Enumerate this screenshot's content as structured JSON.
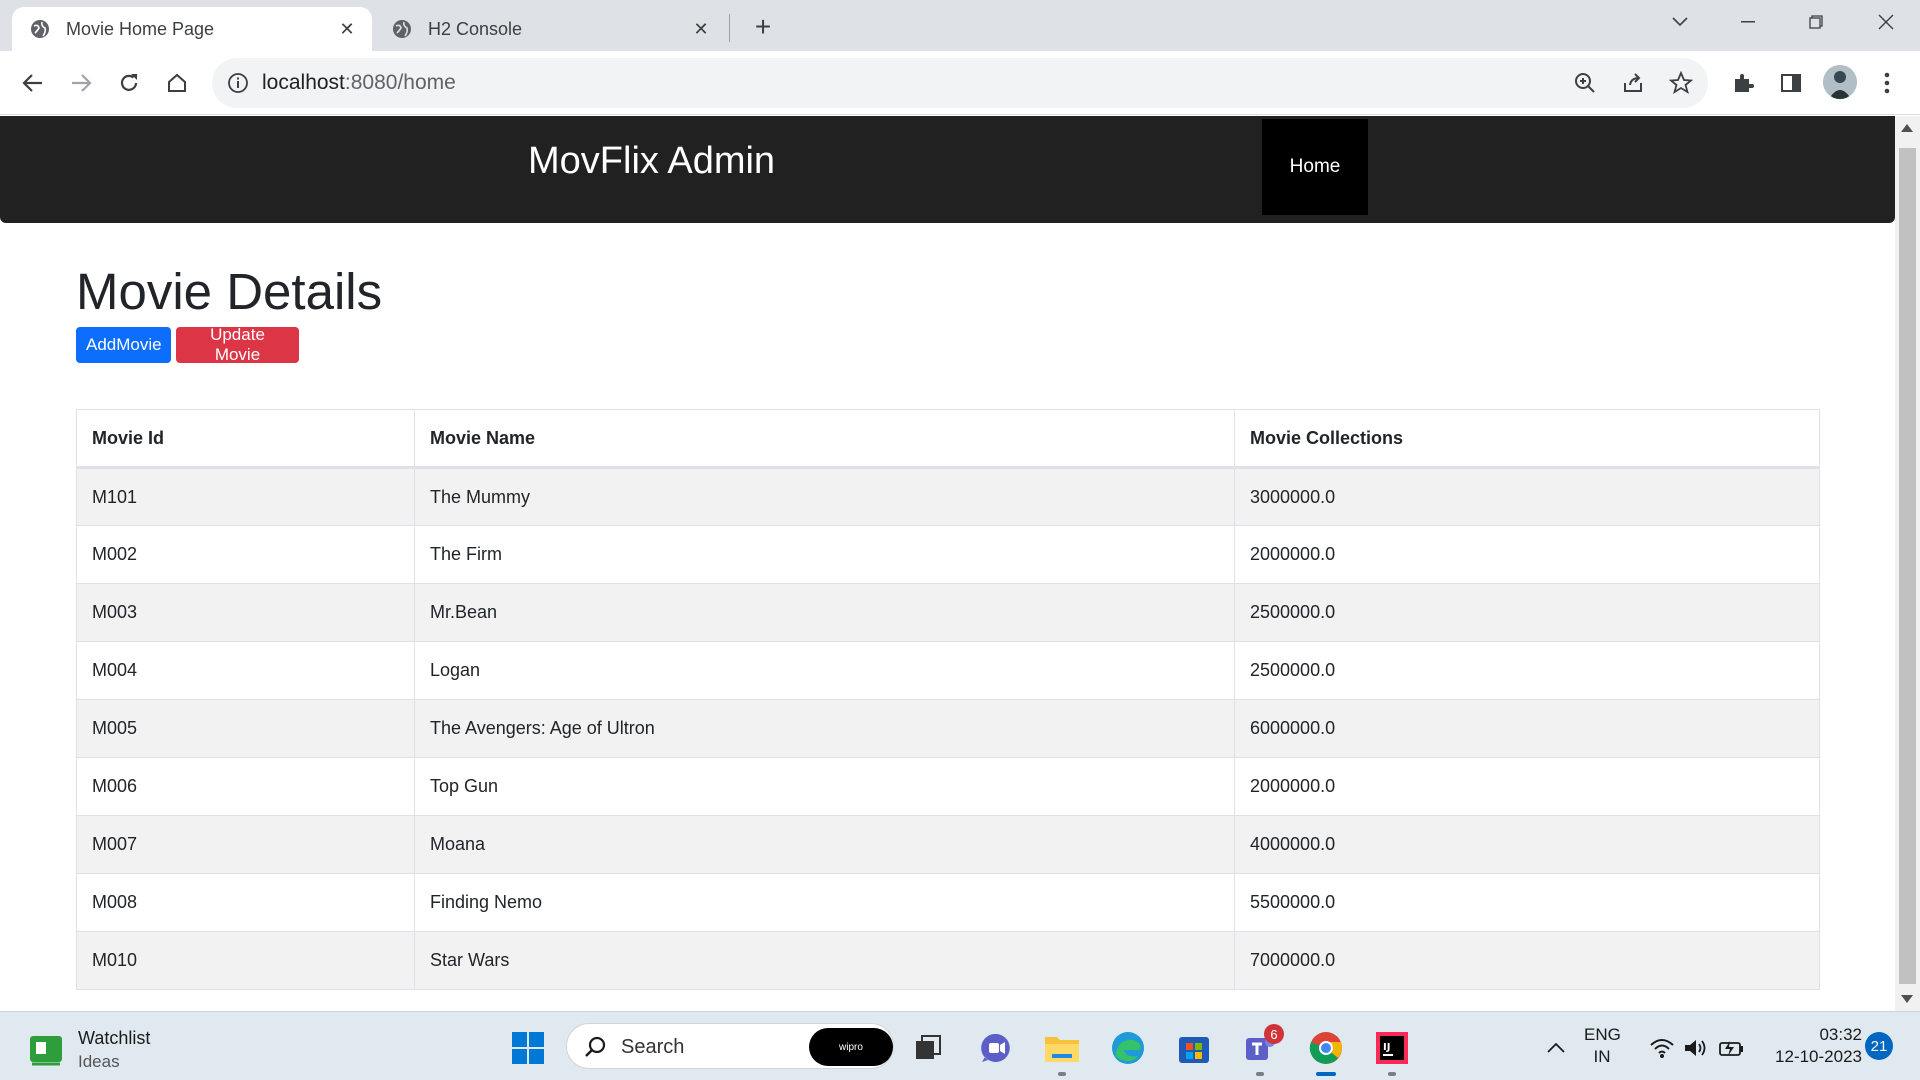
{
  "browser": {
    "tabs": [
      {
        "title": "Movie Home Page",
        "active": true
      },
      {
        "title": "H2 Console",
        "active": false
      }
    ],
    "url_host": "localhost",
    "url_port_path": ":8080/home",
    "icons": [
      "back-arrow-icon",
      "forward-arrow-icon",
      "reload-icon",
      "home-icon",
      "info-icon",
      "zoom-icon",
      "share-icon",
      "star-icon",
      "extensions-icon",
      "side-panel-icon",
      "kebab-menu-icon"
    ]
  },
  "page": {
    "brand": "MovFlix Admin",
    "nav_home": "Home",
    "heading": "Movie Details",
    "add_button": "AddMovie",
    "update_button": "Update Movie",
    "table": {
      "headers": [
        "Movie Id",
        "Movie Name",
        "Movie Collections"
      ],
      "rows": [
        [
          "M101",
          "The Mummy",
          "3000000.0"
        ],
        [
          "M002",
          "The Firm",
          "2000000.0"
        ],
        [
          "M003",
          "Mr.Bean",
          "2500000.0"
        ],
        [
          "M004",
          "Logan",
          "2500000.0"
        ],
        [
          "M005",
          "The Avengers: Age of Ultron",
          "6000000.0"
        ],
        [
          "M006",
          "Top Gun",
          "2000000.0"
        ],
        [
          "M007",
          "Moana",
          "4000000.0"
        ],
        [
          "M008",
          "Finding Nemo",
          "5500000.0"
        ],
        [
          "M010",
          "Star Wars",
          "7000000.0"
        ]
      ]
    },
    "colors": {
      "navbar": "#212121",
      "primary": "#0d6efd",
      "danger": "#dc3545"
    }
  },
  "taskbar": {
    "widget_title": "Watchlist",
    "widget_subtitle": "Ideas",
    "search_placeholder": "Search",
    "search_pill": "wipro",
    "teams_badge": "6",
    "lang_1": "ENG",
    "lang_2": "IN",
    "time": "03:32",
    "date": "12-10-2023",
    "notifications": "21"
  }
}
